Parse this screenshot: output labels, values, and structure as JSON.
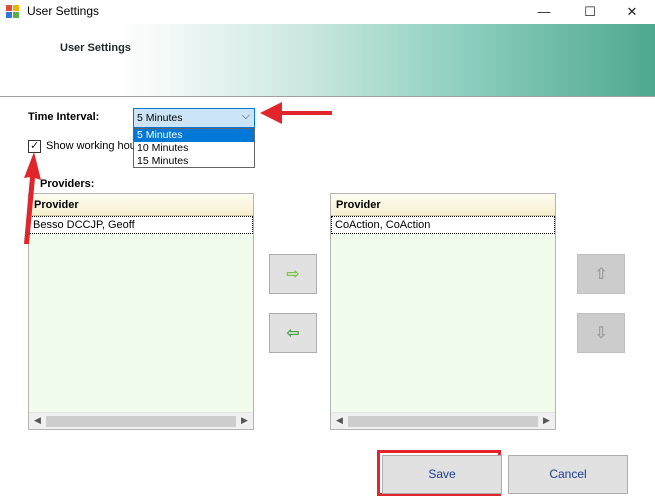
{
  "window": {
    "title": "User Settings",
    "controls": {
      "minimize": "—",
      "maximize": "☐",
      "close": "✕"
    }
  },
  "banner": {
    "title": "User Settings"
  },
  "time_interval": {
    "label": "Time Interval:",
    "selected": "5 Minutes",
    "options": [
      "5 Minutes",
      "10 Minutes",
      "15 Minutes"
    ]
  },
  "working_hours": {
    "label": "Show working hou",
    "checked": true
  },
  "providers_label": "Providers:",
  "left_list": {
    "header": "Provider",
    "rows": [
      "Besso DCCJP, Geoff"
    ]
  },
  "right_list": {
    "header": "Provider",
    "rows": [
      "CoAction, CoAction"
    ]
  },
  "move_buttons": {
    "right": "⇨",
    "left": "⇦",
    "up": "⇧",
    "down": "⇩"
  },
  "buttons": {
    "save": "Save",
    "cancel": "Cancel"
  },
  "colors": {
    "accent": "#0078d7",
    "annotation": "#e0262b",
    "list_bg": "#f1fced",
    "banner_end": "#4ea88f",
    "arrow_right": "#7cc23a",
    "arrow_left": "#43a047"
  }
}
